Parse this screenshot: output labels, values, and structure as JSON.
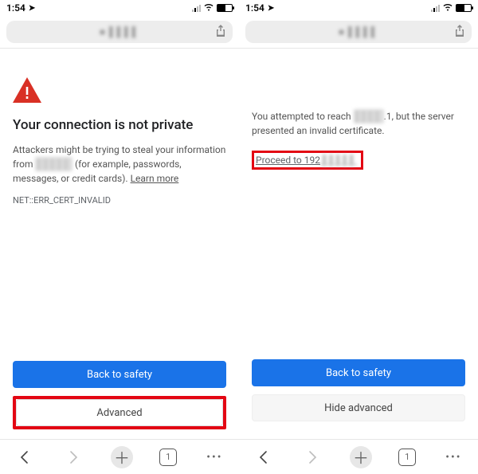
{
  "statusbar": {
    "time": "1:54"
  },
  "url": {
    "obscured_text": "■ ▌▌▌▌"
  },
  "left": {
    "heading": "Your connection is not private",
    "body_pre": "Attackers might be trying to steal your information from ",
    "body_domain": "▌▌▌▌▌",
    "body_post": " (for example, passwords, messages, or credit cards). ",
    "learn_more": "Learn more",
    "error_code": "NET::ERR_CERT_INVALID",
    "back_to_safety": "Back to safety",
    "advanced": "Advanced"
  },
  "right": {
    "adv_pre": "You attempted to reach ",
    "adv_domain": "▌▌▌▌",
    "adv_suffix": ".1",
    "adv_post": ", but the server presented an invalid certificate.",
    "proceed_pre": "Proceed to 192",
    "proceed_blur": " ▌▌▌▌▌",
    "back_to_safety": "Back to safety",
    "hide_advanced": "Hide advanced"
  },
  "toolbar": {
    "tab_count": "1"
  }
}
